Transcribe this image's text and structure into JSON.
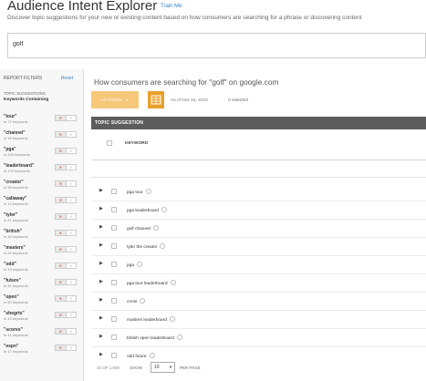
{
  "header": {
    "title": "Audience Intent Explorer",
    "train_link": "Train Me",
    "subtitle": "Discover topic suggestions for your new or existing content based on how consumers are searching for a phrase or discovering content"
  },
  "search": {
    "value": "golf",
    "placeholder": ""
  },
  "sidebar": {
    "heading": "REPORT FILTERS",
    "reset_label": "Reset",
    "section_label": "TOPIC SUGGESTIONS",
    "subsection_label": "Keywords Containing",
    "filters": [
      {
        "label": "\"tour\"",
        "count": "in 72 keywords"
      },
      {
        "label": "\"channel\"",
        "count": "in 18 keywords"
      },
      {
        "label": "\"pga\"",
        "count": "in 205 keywords"
      },
      {
        "label": "\"leaderboard\"",
        "count": "in 179 keywords"
      },
      {
        "label": "\"creator\"",
        "count": "in 36 keywords"
      },
      {
        "label": "\"callaway\"",
        "count": "in 12 keywords"
      },
      {
        "label": "\"tyler\"",
        "count": "in 41 keywords"
      },
      {
        "label": "\"british\"",
        "count": "in 18 keywords"
      },
      {
        "label": "\"masters\"",
        "count": "in 25 keywords"
      },
      {
        "label": "\"odd\"",
        "count": "in 19 keywords"
      },
      {
        "label": "\"future\"",
        "count": "in 31 keywords"
      },
      {
        "label": "\"open\"",
        "count": "in 90 keywords"
      },
      {
        "label": "\"shegrts\"",
        "count": "in 13 keywords"
      },
      {
        "label": "\"scores\"",
        "count": "in 41 keywords"
      },
      {
        "label": "\"espn\"",
        "count": "in 17 keywords"
      }
    ]
  },
  "main": {
    "title": "How consumers are searching for \"golf\" on google.com",
    "actions_label": "ACTIONS",
    "as_of": "As of Nov 16, 2016",
    "selected": "0 selected",
    "table_header": "TOPIC SUGGESTION",
    "column_keyword": "KEYWORD",
    "rows": [
      {
        "keyword": "pga tour"
      },
      {
        "keyword": "pga leaderboard"
      },
      {
        "keyword": "golf channel"
      },
      {
        "keyword": "tyler the creator"
      },
      {
        "keyword": "pga"
      },
      {
        "keyword": "pga tour leaderboard"
      },
      {
        "keyword": "cnnsi"
      },
      {
        "keyword": "masters leaderboard"
      },
      {
        "keyword": "british open leaderboard"
      },
      {
        "keyword": "odd future"
      }
    ],
    "pager": {
      "count": "10 OF 1,000",
      "show_label": "SHOW",
      "per_page_value": "10",
      "per_page_label": "PER PAGE"
    }
  },
  "colors": {
    "accent_orange": "#f7c87a",
    "icon_orange": "#e8a12c",
    "header_gray": "#5d5d5d",
    "link_blue": "#3a7fc1"
  }
}
